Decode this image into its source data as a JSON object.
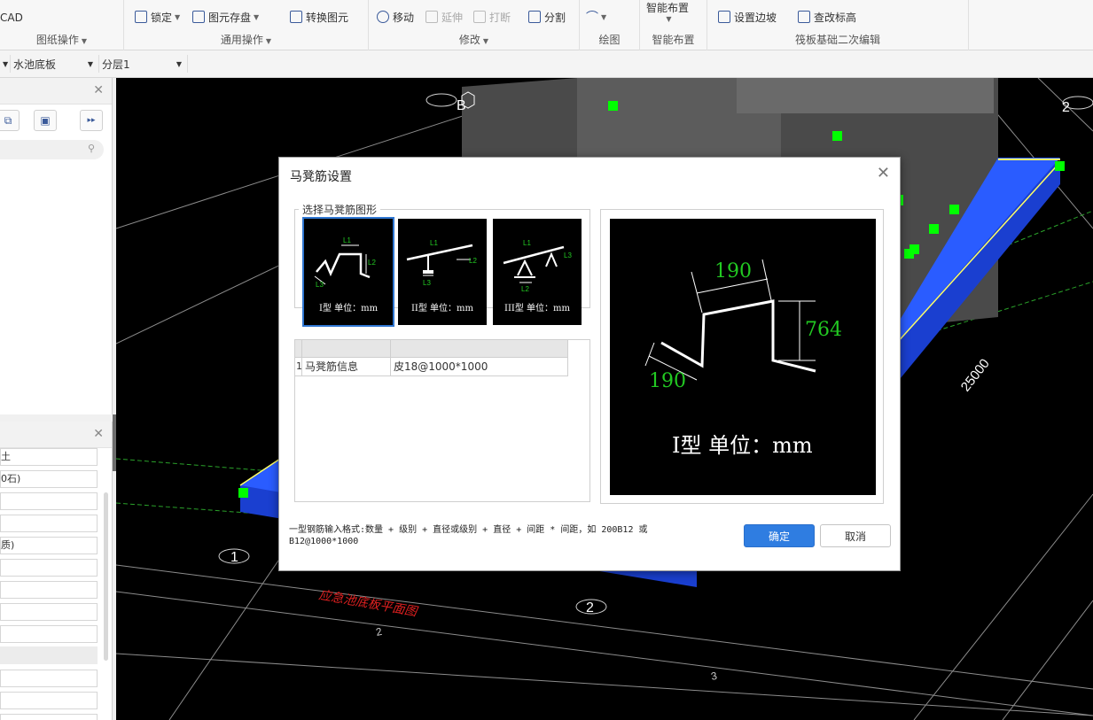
{
  "ribbon": {
    "groups": [
      {
        "label": "图纸操作",
        "items": [
          {
            "label": "CAD"
          }
        ]
      },
      {
        "label": "通用操作",
        "items": [
          {
            "label": "锁定"
          },
          {
            "label": "图元存盘"
          },
          {
            "label": "转换图元"
          }
        ]
      },
      {
        "label": "修改",
        "items": [
          {
            "label": "移动"
          },
          {
            "label": "延伸"
          },
          {
            "label": "打断"
          },
          {
            "label": "分割"
          }
        ]
      },
      {
        "label": "绘图",
        "items": []
      },
      {
        "label": "智能布置",
        "items": [
          {
            "label": "智能布置"
          }
        ]
      },
      {
        "label": "筏板基础二次编辑",
        "items": [
          {
            "label": "设置边坡"
          },
          {
            "label": "查改标高"
          }
        ]
      }
    ]
  },
  "toolbar2": {
    "combo1": "水池底板",
    "combo2": "分层1"
  },
  "props": {
    "rows": [
      "土",
      "0石)",
      "",
      "",
      "质)",
      "",
      "",
      "",
      "",
      "",
      "",
      "",
      ""
    ]
  },
  "canvas": {
    "axis_labels": [
      "B",
      "2",
      "1",
      "2",
      "2",
      "3"
    ],
    "dimension": "25000",
    "drawing_title": "应急池底板平面图"
  },
  "dialog": {
    "title": "马凳筋设置",
    "group_label": "选择马凳筋图形",
    "thumbs": [
      {
        "caption": "I型 单位：mm",
        "l1": "L1",
        "l2": "L2",
        "l3": "L3"
      },
      {
        "caption": "II型 单位：mm",
        "l1": "L1",
        "l2": "L2",
        "l3": "L3"
      },
      {
        "caption": "III型 单位：mm",
        "l1": "L1",
        "l2": "L2",
        "l3": "L3"
      }
    ],
    "table": {
      "headers": [
        "",
        ""
      ],
      "rows": [
        {
          "index": "1",
          "name": "马凳筋信息",
          "value": "⽪18@1000*1000"
        }
      ]
    },
    "preview": {
      "dim_top": "190",
      "dim_right": "764",
      "dim_left": "190",
      "caption": "I型 单位：mm"
    },
    "hint": "一型钢筋输入格式:数量 + 级别 + 直径或级别 + 直径 + 间距 * 间距，如 200B12 或 B12@1000*1000",
    "ok_label": "确定",
    "cancel_label": "取消"
  },
  "colors": {
    "accent": "#2f7de1",
    "canvas_bg": "#000000",
    "slab_blue": "#1a3fd0",
    "marker_green": "#00ff00",
    "dim_green": "#22c922"
  }
}
